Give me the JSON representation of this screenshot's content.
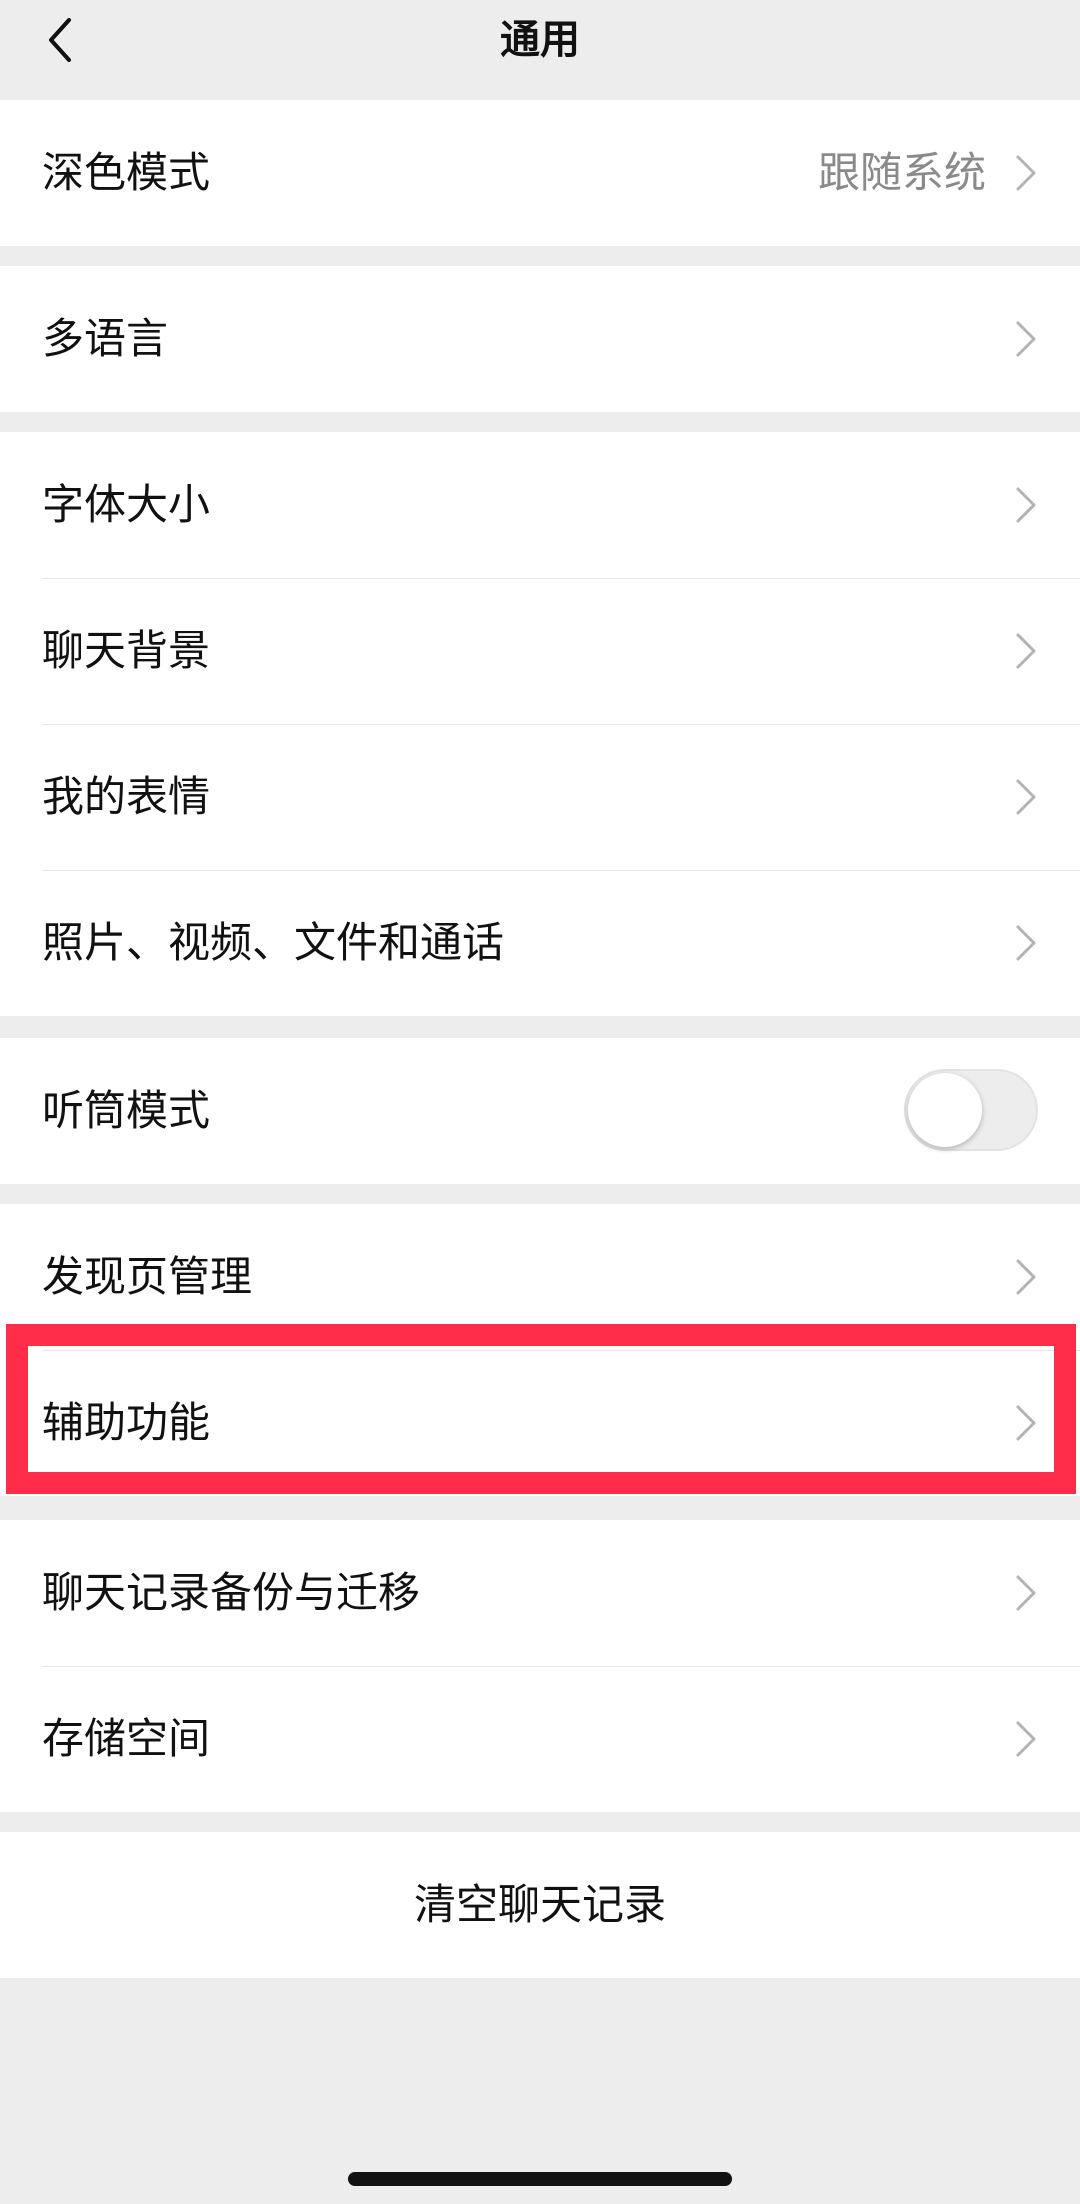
{
  "nav": {
    "title": "通用",
    "back_icon": "chevron-left-icon"
  },
  "groups": [
    {
      "items": [
        {
          "label": "深色模式",
          "value": "跟随系统",
          "control": "chevron"
        }
      ]
    },
    {
      "items": [
        {
          "label": "多语言",
          "control": "chevron"
        }
      ]
    },
    {
      "items": [
        {
          "label": "字体大小",
          "control": "chevron"
        },
        {
          "label": "聊天背景",
          "control": "chevron"
        },
        {
          "label": "我的表情",
          "control": "chevron"
        },
        {
          "label": "照片、视频、文件和通话",
          "control": "chevron"
        }
      ]
    },
    {
      "items": [
        {
          "label": "听筒模式",
          "control": "toggle",
          "toggle_on": false
        }
      ]
    },
    {
      "items": [
        {
          "label": "发现页管理",
          "control": "chevron"
        },
        {
          "label": "辅助功能",
          "control": "chevron",
          "highlighted": true
        }
      ]
    },
    {
      "items": [
        {
          "label": "聊天记录备份与迁移",
          "control": "chevron"
        },
        {
          "label": "存储空间",
          "control": "chevron"
        }
      ]
    },
    {
      "items": [
        {
          "label": "清空聊天记录",
          "control": "none"
        }
      ]
    }
  ],
  "colors": {
    "page_background": "#ededed",
    "row_background": "#ffffff",
    "highlight": "#ff2d4a",
    "secondary_text": "#8a8a8a"
  }
}
